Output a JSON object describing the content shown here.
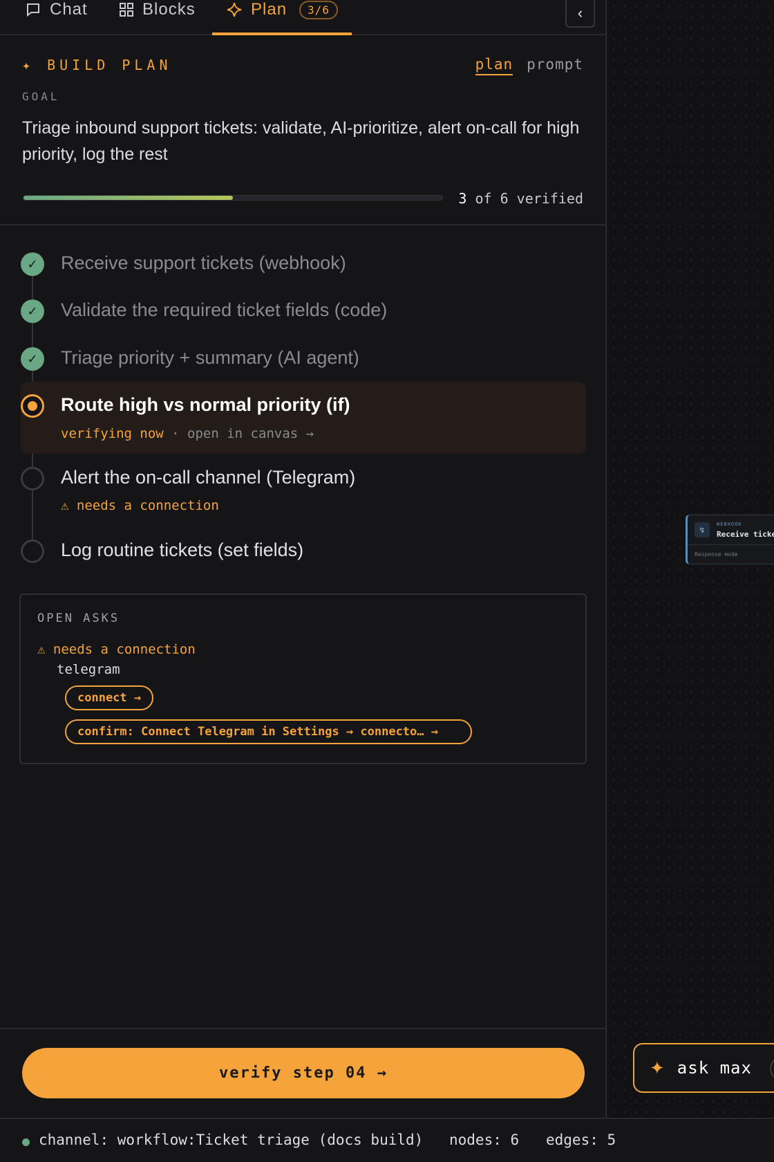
{
  "tabs": {
    "chat": "Chat",
    "blocks": "Blocks",
    "plan": "Plan",
    "plan_badge": "3/6"
  },
  "header": {
    "build_plan": "✦ BUILD PLAN",
    "toggle_plan": "plan",
    "toggle_prompt": "prompt",
    "goal_label": "GOAL",
    "goal_text": "Triage inbound support tickets: validate, AI-prioritize, alert on-call for high priority, log the rest"
  },
  "progress": {
    "verified": 3,
    "total": 6,
    "fraction": 0.5,
    "count": "3",
    "suffix": "of 6 verified"
  },
  "steps": [
    {
      "title": "Receive support tickets (webhook)",
      "status": "done"
    },
    {
      "title": "Validate the required ticket fields (code)",
      "status": "done"
    },
    {
      "title": "Triage priority + summary (AI agent)",
      "status": "done"
    },
    {
      "title": "Route high vs normal priority (if)",
      "status": "active",
      "sub_status": "verifying now",
      "sub_link": "· open in canvas →"
    },
    {
      "title": "Alert the on-call channel (Telegram)",
      "status": "todo",
      "warning": "⚠ needs a connection"
    },
    {
      "title": "Log routine tickets (set fields)",
      "status": "todo"
    }
  ],
  "open_asks": {
    "title": "OPEN ASKS",
    "warning": "⚠ needs a connection",
    "service": "telegram",
    "connect_label": "connect →",
    "confirm_label": "confirm: Connect Telegram in Settings → connecto… →"
  },
  "verify_button": "verify step 04 →",
  "canvas": {
    "node_kind": "WEBHOOK",
    "node_title": "Receive tickets",
    "node_field": "Response mode",
    "ask_max": "ask max"
  },
  "status_bar": {
    "channel": "channel: workflow:Ticket triage (docs build)",
    "nodes": "nodes: 6",
    "edges": "edges: 5"
  },
  "colors": {
    "accent": "#f5a33b",
    "done": "#6aa885",
    "background": "#151518"
  },
  "icons": [
    "chat-bubble-icon",
    "grid-icon",
    "sparkle-icon",
    "chevron-left-icon",
    "check-icon",
    "warning-icon",
    "webhook-icon"
  ]
}
